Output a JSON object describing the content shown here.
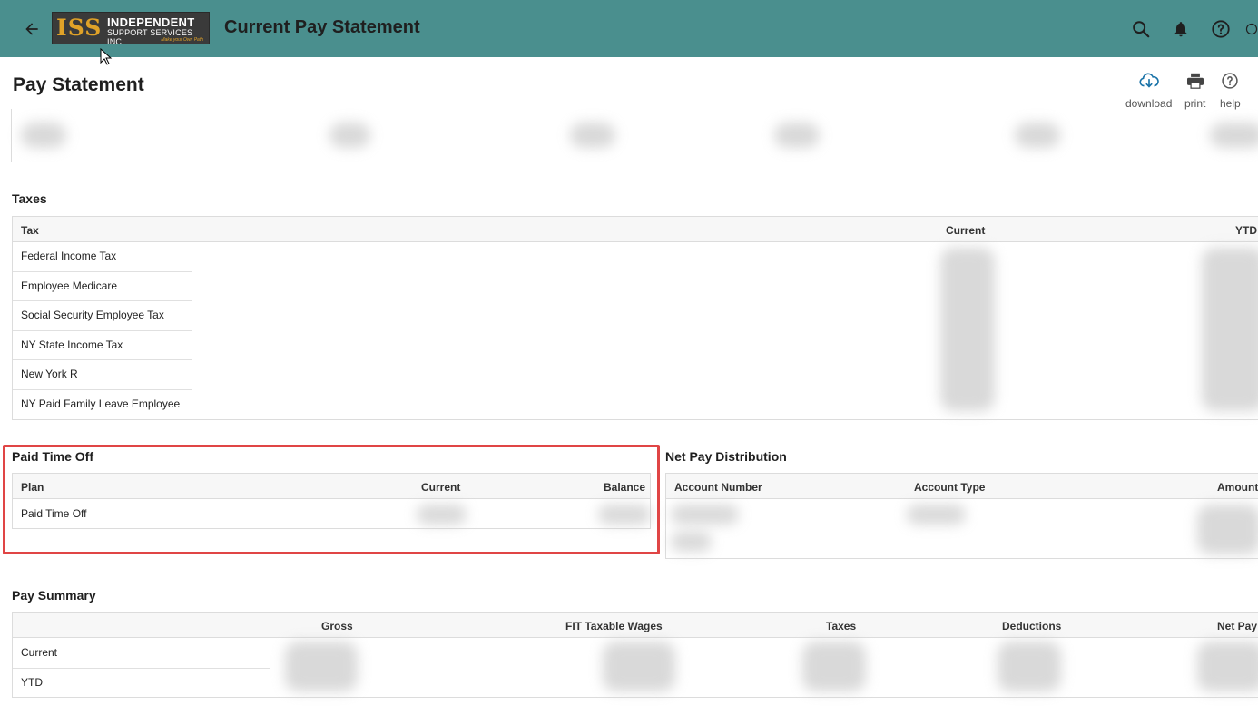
{
  "header": {
    "logo": {
      "mark": "ISS",
      "line1": "INDEPENDENT",
      "line2": "SUPPORT SERVICES INC.",
      "tagline": "Make your Own Path"
    },
    "title": "Current Pay Statement",
    "icons": [
      "back-arrow-icon",
      "search-icon",
      "bell-icon",
      "help-circle-icon",
      "user-circle-icon"
    ]
  },
  "page": {
    "title": "Pay Statement",
    "actions": [
      {
        "label": "download",
        "icon": "cloud-download-icon"
      },
      {
        "label": "print",
        "icon": "printer-icon"
      },
      {
        "label": "help",
        "icon": "help-circle-icon"
      }
    ]
  },
  "taxes": {
    "title": "Taxes",
    "columns": [
      "Tax",
      "Current",
      "YTD"
    ],
    "rows": [
      "Federal Income Tax",
      "Employee Medicare",
      "Social Security Employee Tax",
      "NY State Income Tax",
      "New York R",
      "NY Paid Family Leave Employee"
    ]
  },
  "pto": {
    "title": "Paid Time Off",
    "columns": [
      "Plan",
      "Current",
      "Balance"
    ],
    "rows": [
      "Paid Time Off"
    ]
  },
  "net_pay": {
    "title": "Net Pay Distribution",
    "columns": [
      "Account Number",
      "Account Type",
      "Amount"
    ]
  },
  "summary": {
    "title": "Pay Summary",
    "columns": [
      "Gross",
      "FIT Taxable Wages",
      "Taxes",
      "Deductions",
      "Net Pay"
    ],
    "rows": [
      "Current",
      "YTD"
    ]
  },
  "colors": {
    "topbar": "#4a8f8e",
    "highlight": "#e04545",
    "accent_icon": "#1a73a8"
  }
}
